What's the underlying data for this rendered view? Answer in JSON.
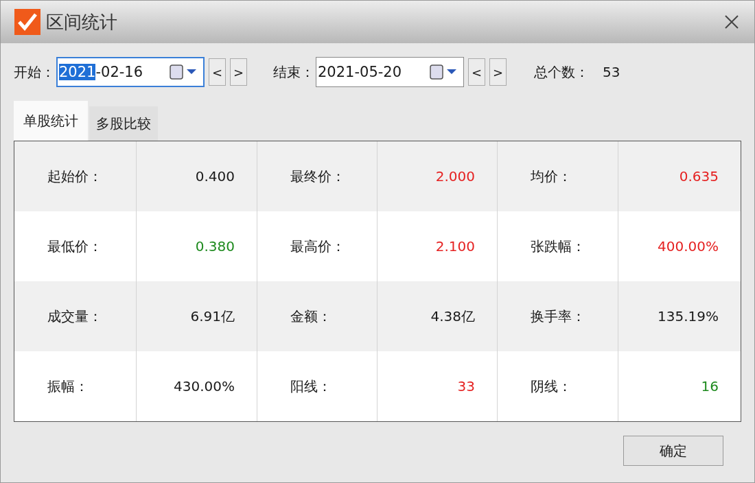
{
  "window": {
    "title": "区间统计"
  },
  "range": {
    "start": {
      "label": "开始：",
      "selected_text": "2021",
      "value": "-02-16"
    },
    "end": {
      "label": "结束：",
      "value": "2021-05-20"
    },
    "prev": "<",
    "next": ">",
    "total_label": "总个数：",
    "total": "53"
  },
  "tabs": [
    {
      "label": "单股统计",
      "selected": true
    },
    {
      "label": "多股比较",
      "selected": false
    }
  ],
  "table": {
    "rows": [
      [
        {
          "label": "起始价：",
          "value": "0.400",
          "color": "#1a1a1a"
        },
        {
          "label": "最终价：",
          "value": "2.000",
          "color": "#e52222"
        },
        {
          "label": "均价：",
          "value": "0.635",
          "color": "#e52222"
        }
      ],
      [
        {
          "label": "最低价：",
          "value": "0.380",
          "color": "#1e8a1e"
        },
        {
          "label": "最高价：",
          "value": "2.100",
          "color": "#e52222"
        },
        {
          "label": "张跌幅：",
          "value": "400.00%",
          "color": "#e52222"
        }
      ],
      [
        {
          "label": "成交量：",
          "value": "6.91亿",
          "color": "#1a1a1a"
        },
        {
          "label": "金额：",
          "value": "4.38亿",
          "color": "#1a1a1a"
        },
        {
          "label": "换手率：",
          "value": "135.19%",
          "color": "#1a1a1a"
        }
      ],
      [
        {
          "label": "振幅：",
          "value": "430.00%",
          "color": "#1a1a1a"
        },
        {
          "label": "阳线：",
          "value": "33",
          "color": "#e52222"
        },
        {
          "label": "阴线：",
          "value": "16",
          "color": "#1e8a1e"
        }
      ]
    ]
  },
  "ok_button": "确定"
}
